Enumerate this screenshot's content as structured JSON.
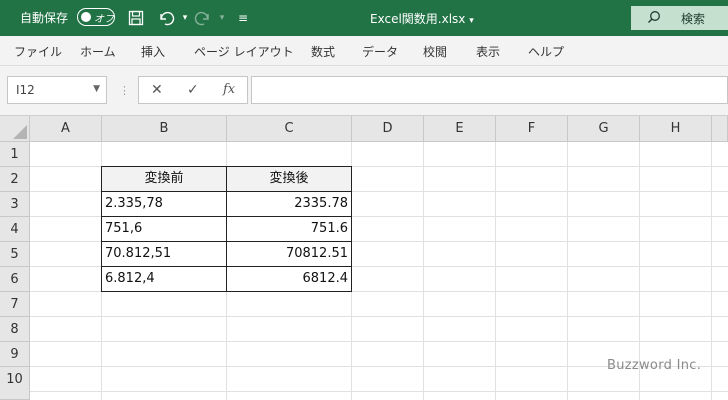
{
  "titlebar": {
    "autosave_label": "自動保存",
    "autosave_state": "オフ",
    "doc_title": "Excel関数用.xlsx",
    "search_label": "検索"
  },
  "menu": [
    "ファイル",
    "ホーム",
    "挿入",
    "ページ レイアウト",
    "数式",
    "データ",
    "校閲",
    "表示",
    "ヘルプ"
  ],
  "formula_bar": {
    "name_box": "I12",
    "cancel": "✕",
    "enter": "✓",
    "fx": "fx",
    "value": ""
  },
  "columns": [
    "A",
    "B",
    "C",
    "D",
    "E",
    "F",
    "G",
    "H"
  ],
  "rows": [
    "1",
    "2",
    "3",
    "4",
    "5",
    "6",
    "7",
    "8",
    "9",
    "10"
  ],
  "table": {
    "headers": [
      "変換前",
      "変換後"
    ],
    "rows": [
      [
        "2.335,78",
        "2335.78"
      ],
      [
        "751,6",
        "751.6"
      ],
      [
        "70.812,51",
        "70812.51"
      ],
      [
        "6.812,4",
        "6812.4"
      ]
    ]
  },
  "watermark": "Buzzword Inc.",
  "colors": {
    "brand": "#217346",
    "search_bg": "#c6e0d0"
  }
}
